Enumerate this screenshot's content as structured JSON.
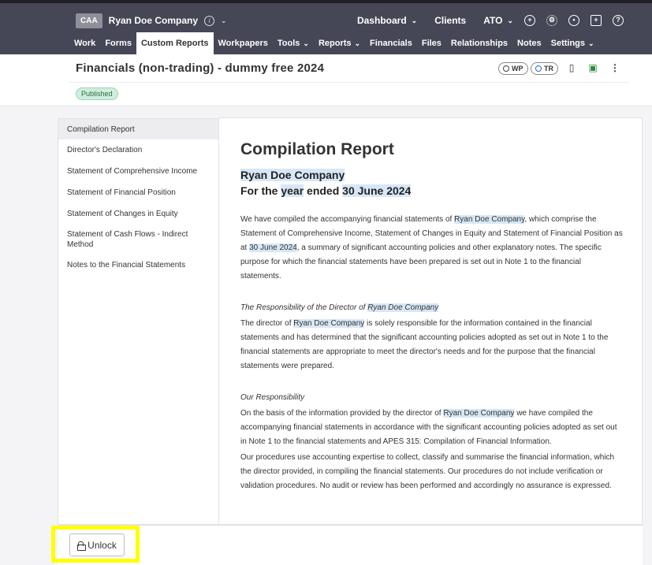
{
  "org": {
    "badge": "CAA",
    "name": "Ryan Doe Company"
  },
  "top_nav": {
    "dashboard": "Dashboard",
    "clients": "Clients",
    "ato": "ATO"
  },
  "main_nav": [
    {
      "label": "Work"
    },
    {
      "label": "Forms"
    },
    {
      "label": "Custom Reports"
    },
    {
      "label": "Workpapers"
    },
    {
      "label": "Tools"
    },
    {
      "label": "Reports"
    },
    {
      "label": "Financials"
    },
    {
      "label": "Files"
    },
    {
      "label": "Relationships"
    },
    {
      "label": "Notes"
    },
    {
      "label": "Settings"
    }
  ],
  "header": {
    "title": "Financials (non-trading) - dummy free 2024",
    "pill_wp": "WP",
    "pill_tr": "TR",
    "status": "Published"
  },
  "sidebar": {
    "items": [
      {
        "label": "Compilation Report"
      },
      {
        "label": "Director's Declaration"
      },
      {
        "label": "Statement of Comprehensive Income"
      },
      {
        "label": "Statement of Financial Position"
      },
      {
        "label": "Statement of Changes in Equity"
      },
      {
        "label": "Statement of Cash Flows - Indirect Method"
      },
      {
        "label": "Notes to the Financial Statements"
      }
    ]
  },
  "report": {
    "title": "Compilation Report",
    "company": "Ryan Doe Company",
    "period_pre": "For the ",
    "period_year": "year",
    "period_mid": " ended ",
    "period_date": "30 June 2024",
    "p1_a": "We have compiled the accompanying financial statements of ",
    "p1_company": "Ryan Doe Company",
    "p1_b": ", which comprise the Statement of Comprehensive Income, Statement of Changes in Equity and Statement of Financial Position as at ",
    "p1_date": "30 June 2024",
    "p1_c": ", a summary of significant accounting policies and other explanatory notes. The specific purpose for which the financial statements have been prepared is set out in Note 1 to the financial statements.",
    "resp_heading_a": "The Responsibility of the Director of ",
    "resp_heading_company": "Ryan Doe Company",
    "p2_a": "The director of ",
    "p2_company": "Ryan Doe Company",
    "p2_b": " is solely responsible for the information contained in the financial statements and has determined that the significant accounting policies adopted as set out in Note 1 to the financial statements are appropriate to meet the director's needs and for the purpose that the financial statements were prepared.",
    "our_heading": "Our Responsibility",
    "p3_a": "On the basis of the information provided by the director of ",
    "p3_company": "Ryan Doe Company",
    "p3_b": " we have compiled the accompanying financial statements in accordance with the significant accounting policies adopted as set out in Note 1 to the financial statements and APES 315: Compilation of Financial Information.",
    "p4": "Our procedures use accounting expertise to collect, classify and summarise the financial information, which the director provided, in compiling the financial statements. Our procedures do not include verification or validation procedures. No audit or review has been performed and accordingly no assurance is expressed."
  },
  "footer": {
    "unlock_label": "Unlock"
  },
  "colors": {
    "topbar": "#454656",
    "highlight": "#d7e7f7",
    "published_bg": "#cfeedd",
    "focus_outline": "#ffff00"
  },
  "icons": [
    "info-icon",
    "plus-circle-icon",
    "gear-icon",
    "user-circle-icon",
    "gift-icon",
    "help-icon",
    "pdf-icon",
    "clipboard-add-icon",
    "kebab-menu-icon",
    "lock-icon"
  ]
}
